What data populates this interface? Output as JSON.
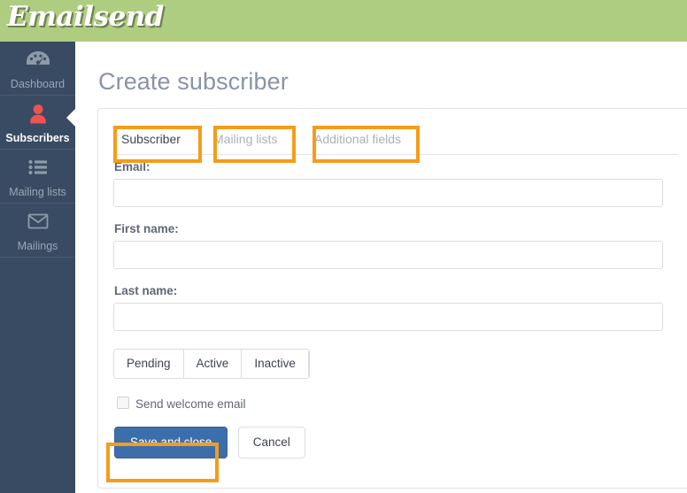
{
  "header": {
    "logo_text": "Emailsend",
    "logo_bg_color": "#aecd80"
  },
  "sidebar": {
    "bg_color": "#384b63",
    "active_icon_color": "#ef5350",
    "items": [
      {
        "label": "Dashboard",
        "icon": "tachometer-icon",
        "active": false
      },
      {
        "label": "Subscribers",
        "icon": "user-icon",
        "active": true
      },
      {
        "label": "Mailing lists",
        "icon": "list-icon",
        "active": false
      },
      {
        "label": "Mailings",
        "icon": "envelope-icon",
        "active": false
      }
    ]
  },
  "main": {
    "page_title": "Create subscriber",
    "tabs": [
      {
        "label": "Subscriber",
        "active": true
      },
      {
        "label": "Mailing lists",
        "active": false
      },
      {
        "label": "Additional fields",
        "active": false
      }
    ],
    "form": {
      "email": {
        "label": "Email:",
        "value": "",
        "placeholder": ""
      },
      "first_name": {
        "label": "First name:",
        "value": "",
        "placeholder": ""
      },
      "last_name": {
        "label": "Last name:",
        "value": "",
        "placeholder": ""
      },
      "status_options": [
        "Pending",
        "Active",
        "Inactive"
      ],
      "status_selected": "",
      "welcome_email": {
        "label": "Send welcome email",
        "checked": false
      }
    },
    "buttons": {
      "save_label": "Save and close",
      "cancel_label": "Cancel",
      "primary_color": "#3c6eab"
    }
  },
  "annotations": {
    "color": "#f59c1a",
    "boxes": [
      "tab-subscriber",
      "tab-mailing-lists",
      "tab-additional-fields",
      "save-and-close-button"
    ]
  }
}
